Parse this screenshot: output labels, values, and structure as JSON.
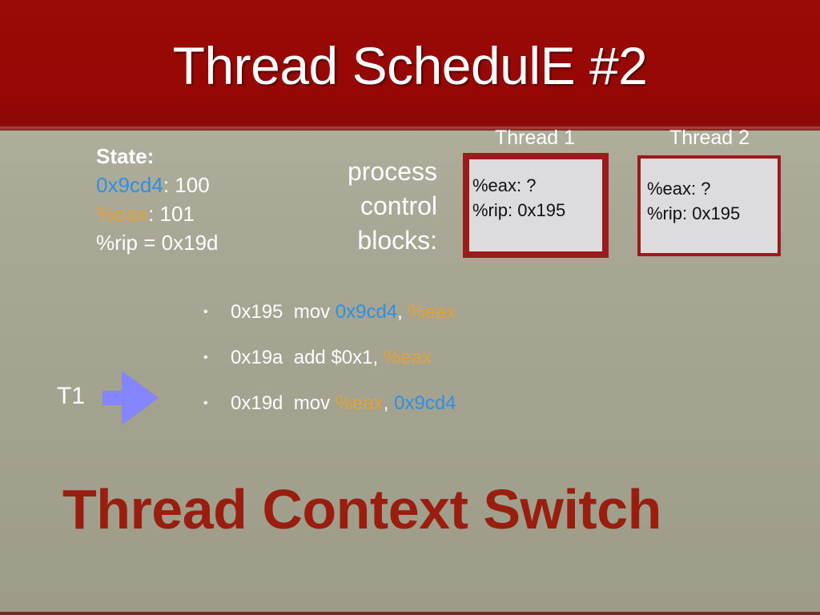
{
  "slide": {
    "title": "Thread SchedulE #2",
    "state": {
      "label": "State:",
      "memory_address": "0x9cd4",
      "memory_value": ": 100",
      "register_name": "%eax",
      "register_value": ": 101",
      "rip_line": "%rip = 0x19d"
    },
    "pcb_label": [
      "process",
      "control",
      "blocks:"
    ],
    "threads": [
      {
        "name": "Thread 1",
        "eax_line": "%eax: ?",
        "rip_line": "%rip: 0x195"
      },
      {
        "name": "Thread 2",
        "eax_line": "%eax: ?",
        "rip_line": "%rip: 0x195"
      }
    ],
    "code": [
      {
        "bullet": "•",
        "addr": "0x195",
        "op": "mov",
        "arg1": "0x9cd4",
        "sep": ", ",
        "arg2": "%eax"
      },
      {
        "bullet": "•",
        "addr": "0x19a",
        "op": "add",
        "arg1": "$0x1",
        "sep": ", ",
        "arg2": "%eax"
      },
      {
        "bullet": "•",
        "addr": "0x19d",
        "op": "mov",
        "arg1": "%eax",
        "sep": ", ",
        "arg2": "0x9cd4"
      }
    ],
    "pointer": {
      "label": "T1",
      "icon": "right-arrow-icon",
      "current_line_index": 2
    },
    "big_heading": "Thread Context Switch",
    "colors": {
      "header": "#960805",
      "memory_highlight": "#2f8fe0",
      "register_highlight": "#e2a23a",
      "heading_red": "#9a1e10",
      "arrow": "#8585ff",
      "pcb_border": "#9b1b1c"
    }
  }
}
